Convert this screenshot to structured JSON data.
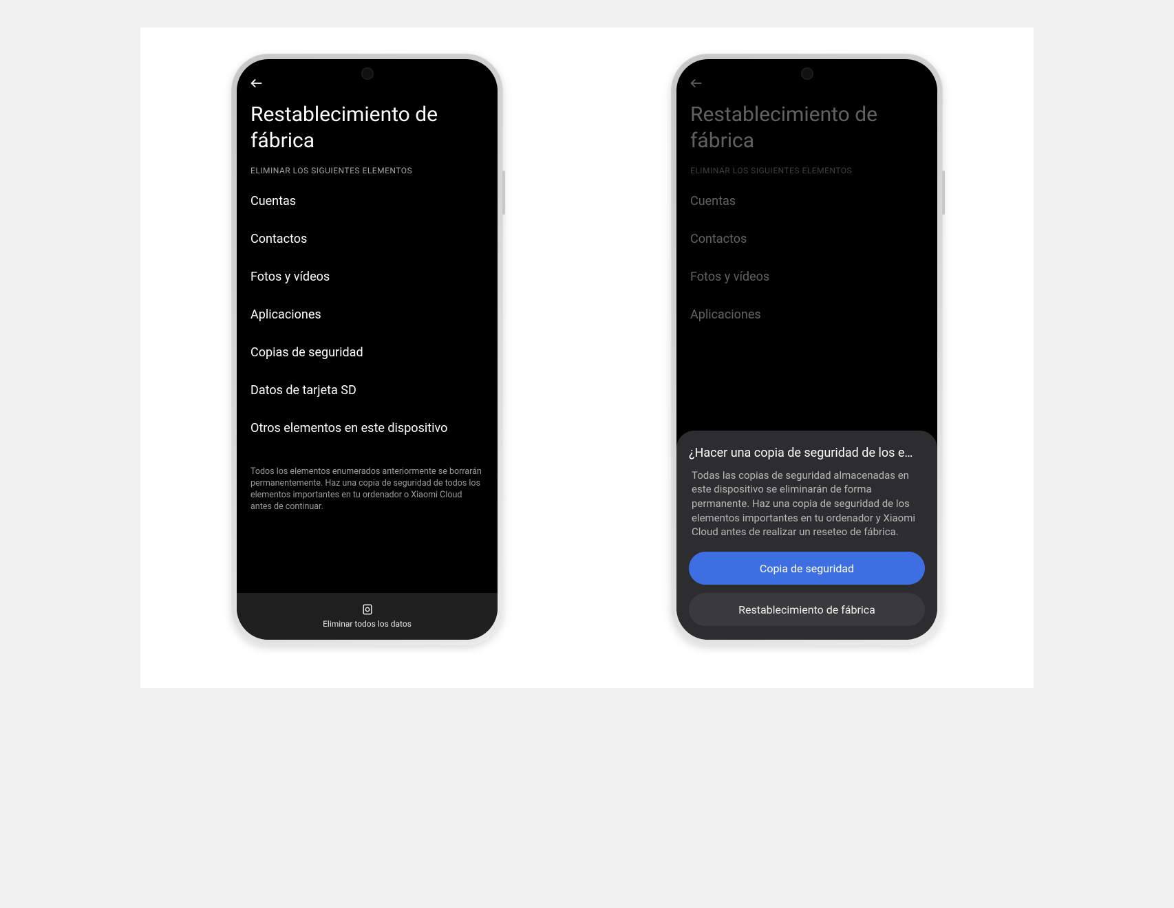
{
  "left": {
    "title": "Restablecimiento de fábrica",
    "caption": "ELIMINAR LOS SIGUIENTES ELEMENTOS",
    "items": [
      "Cuentas",
      "Contactos",
      "Fotos y vídeos",
      "Aplicaciones",
      "Copias de seguridad",
      "Datos de tarjeta SD",
      "Otros elementos en este dispositivo"
    ],
    "disclaimer": "Todos los elementos enumerados anteriormente se borrarán permanentemente. Haz una copia de seguridad de todos los elementos importantes en tu ordenador o Xiaomi Cloud antes de continuar.",
    "bottom_action": "Eliminar todos los datos"
  },
  "right": {
    "title": "Restablecimiento de fábrica",
    "caption": "ELIMINAR LOS SIGUIENTES ELEMENTOS",
    "items": [
      "Cuentas",
      "Contactos",
      "Fotos y vídeos",
      "Aplicaciones"
    ],
    "sheet": {
      "title": "¿Hacer una copia de seguridad de los e…",
      "body": "Todas las copias de seguridad almacenadas en este dispositivo se eliminarán de forma permanente. Haz una copia de seguridad de los elementos importantes en tu ordenador y Xiaomi Cloud antes de realizar un reseteo de fábrica.",
      "primary": "Copia de seguridad",
      "secondary": "Restablecimiento de fábrica"
    }
  }
}
